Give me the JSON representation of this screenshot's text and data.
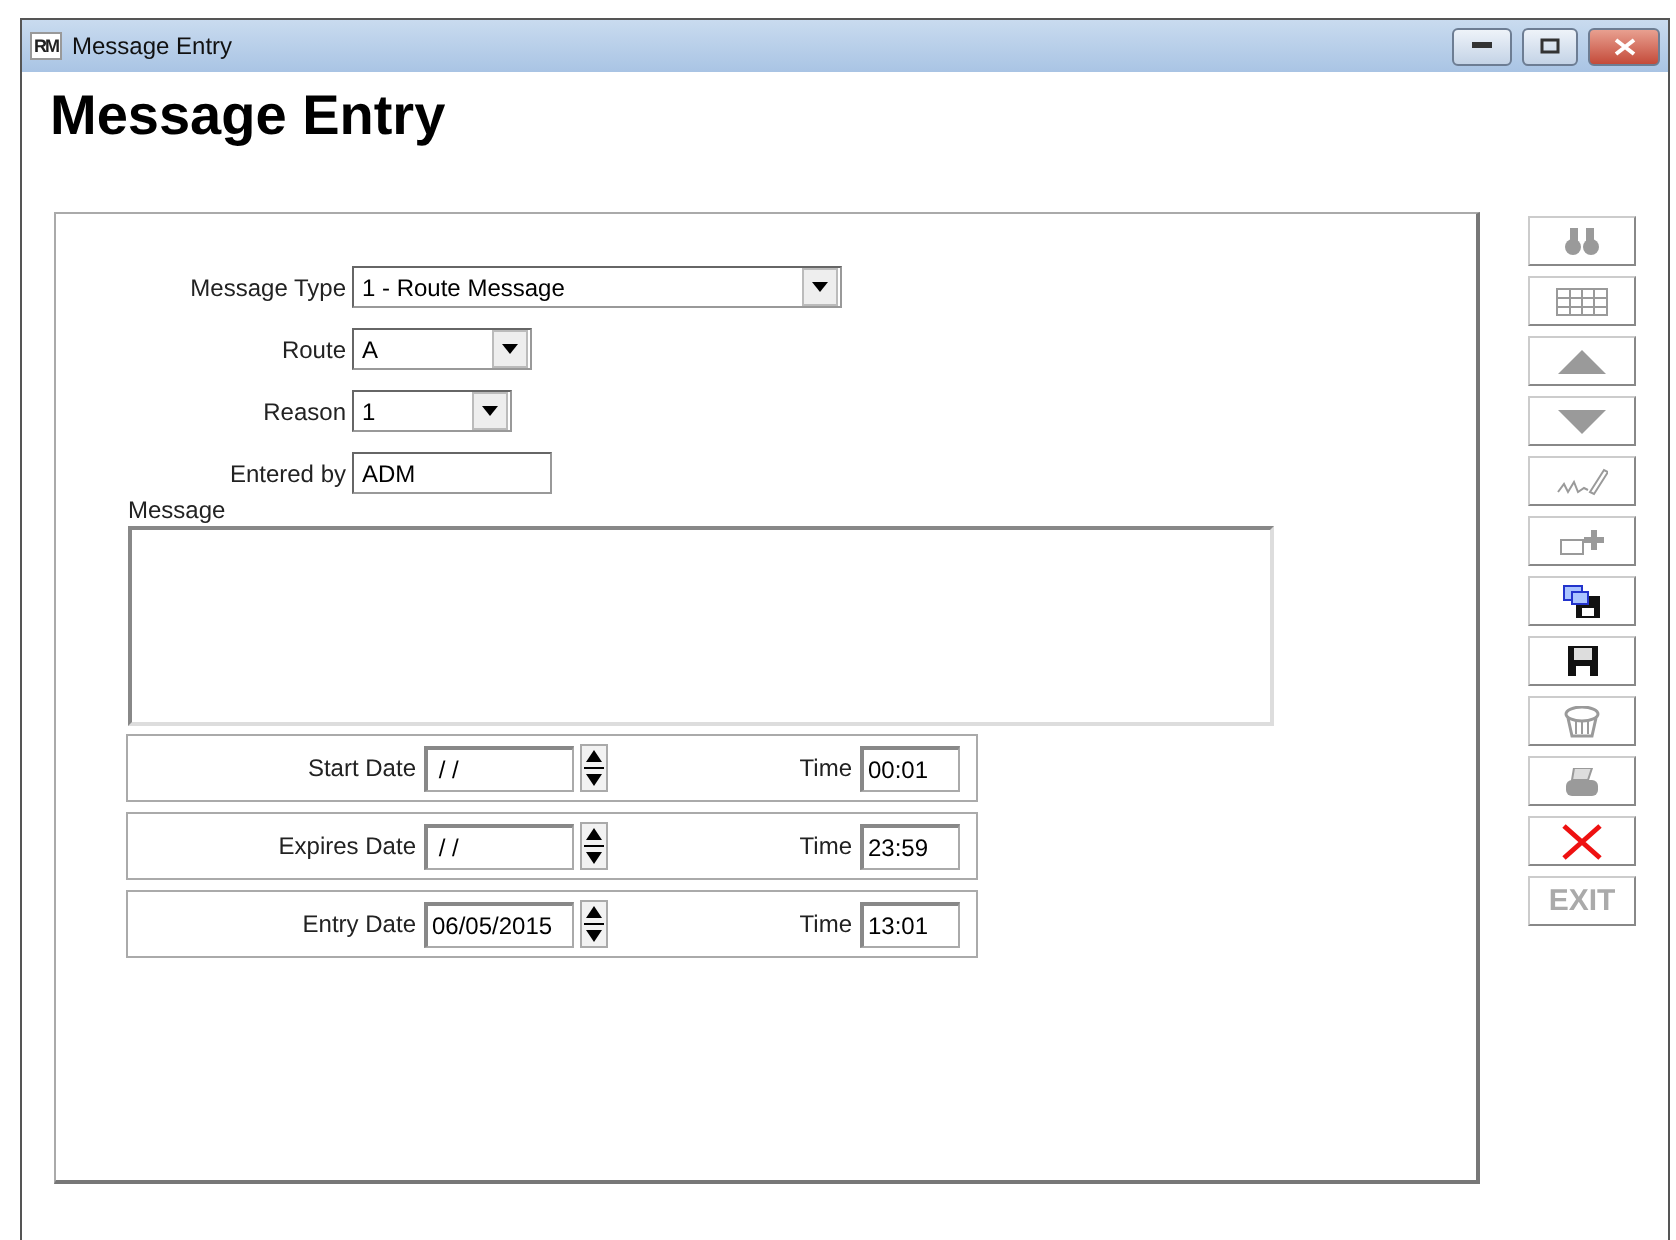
{
  "window": {
    "app_icon": "RM",
    "title": "Message Entry"
  },
  "heading": "Message Entry",
  "form": {
    "selects": [
      {
        "label": "Message Type",
        "value": "1 - Route Message",
        "kind": "dropdown"
      },
      {
        "label": "Route",
        "value": "A",
        "kind": "dropdown"
      },
      {
        "label": "Reason",
        "value": "1",
        "kind": "dropdown"
      },
      {
        "label": "Entered by",
        "value": "ADM",
        "kind": "text"
      }
    ],
    "message": {
      "label": "Message"
    },
    "date_rows": [
      {
        "date_label": "Start Date",
        "date": " / /",
        "time_label": "Time",
        "time": "00:01"
      },
      {
        "date_label": "Expires Date",
        "date": " / /",
        "time_label": "Time",
        "time": "23:59"
      },
      {
        "date_label": "Entry Date",
        "date": "06/05/2015",
        "time_label": "Time",
        "time": "13:01"
      }
    ]
  },
  "toolbar": [
    {
      "kind": "binoculars",
      "disabled": true
    },
    {
      "kind": "grid",
      "disabled": true
    },
    {
      "kind": "up",
      "disabled": true
    },
    {
      "kind": "down",
      "disabled": true
    },
    {
      "kind": "signature",
      "disabled": true
    },
    {
      "kind": "add",
      "disabled": true
    },
    {
      "kind": "save_as",
      "disabled": false
    },
    {
      "kind": "save",
      "disabled": false
    },
    {
      "kind": "trash",
      "disabled": true
    },
    {
      "kind": "print",
      "disabled": true
    },
    {
      "kind": "close",
      "disabled": false
    },
    {
      "kind": "exit",
      "label": "EXIT",
      "disabled": true
    }
  ]
}
